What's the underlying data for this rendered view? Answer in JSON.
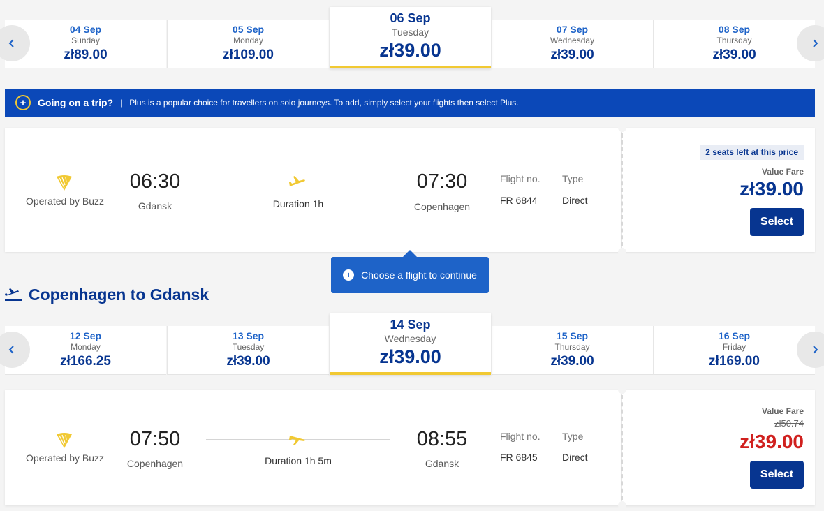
{
  "outbound": {
    "dates": [
      {
        "date": "04 Sep",
        "weekday": "Sunday",
        "price": "zł89.00"
      },
      {
        "date": "05 Sep",
        "weekday": "Monday",
        "price": "zł109.00"
      },
      {
        "date": "06 Sep",
        "weekday": "Tuesday",
        "price": "zł39.00"
      },
      {
        "date": "07 Sep",
        "weekday": "Wednesday",
        "price": "zł39.00"
      },
      {
        "date": "08 Sep",
        "weekday": "Thursday",
        "price": "zł39.00"
      }
    ],
    "flight": {
      "operated_by": "Operated by Buzz",
      "dep_time": "06:30",
      "dep_city": "Gdansk",
      "duration": "Duration 1h",
      "arr_time": "07:30",
      "arr_city": "Copenhagen",
      "flight_no_label": "Flight no.",
      "flight_no": "FR 6844",
      "type_label": "Type",
      "type": "Direct",
      "seats_left": "2 seats left at this price",
      "fare_name": "Value Fare",
      "price": "zł39.00",
      "select_label": "Select"
    }
  },
  "banner": {
    "title": "Going on a trip?",
    "divider": "|",
    "text": "Plus is a popular choice for travellers on solo journeys. To add, simply select your flights then select Plus."
  },
  "tooltip": {
    "text": "Choose a flight to continue"
  },
  "return_section": {
    "title": "Copenhagen to Gdansk"
  },
  "inbound": {
    "dates": [
      {
        "date": "12 Sep",
        "weekday": "Monday",
        "price": "zł166.25"
      },
      {
        "date": "13 Sep",
        "weekday": "Tuesday",
        "price": "zł39.00"
      },
      {
        "date": "14 Sep",
        "weekday": "Wednesday",
        "price": "zł39.00"
      },
      {
        "date": "15 Sep",
        "weekday": "Thursday",
        "price": "zł39.00"
      },
      {
        "date": "16 Sep",
        "weekday": "Friday",
        "price": "zł169.00"
      }
    ],
    "flight": {
      "operated_by": "Operated by Buzz",
      "dep_time": "07:50",
      "dep_city": "Copenhagen",
      "duration": "Duration 1h 5m",
      "arr_time": "08:55",
      "arr_city": "Gdansk",
      "flight_no_label": "Flight no.",
      "flight_no": "FR 6845",
      "type_label": "Type",
      "type": "Direct",
      "fare_name": "Value Fare",
      "old_price": "zł50.74",
      "price": "zł39.00",
      "select_label": "Select"
    }
  },
  "colors": {
    "brand_blue": "#073590",
    "accent_yellow": "#f1c933",
    "sale_red": "#d0201e"
  }
}
